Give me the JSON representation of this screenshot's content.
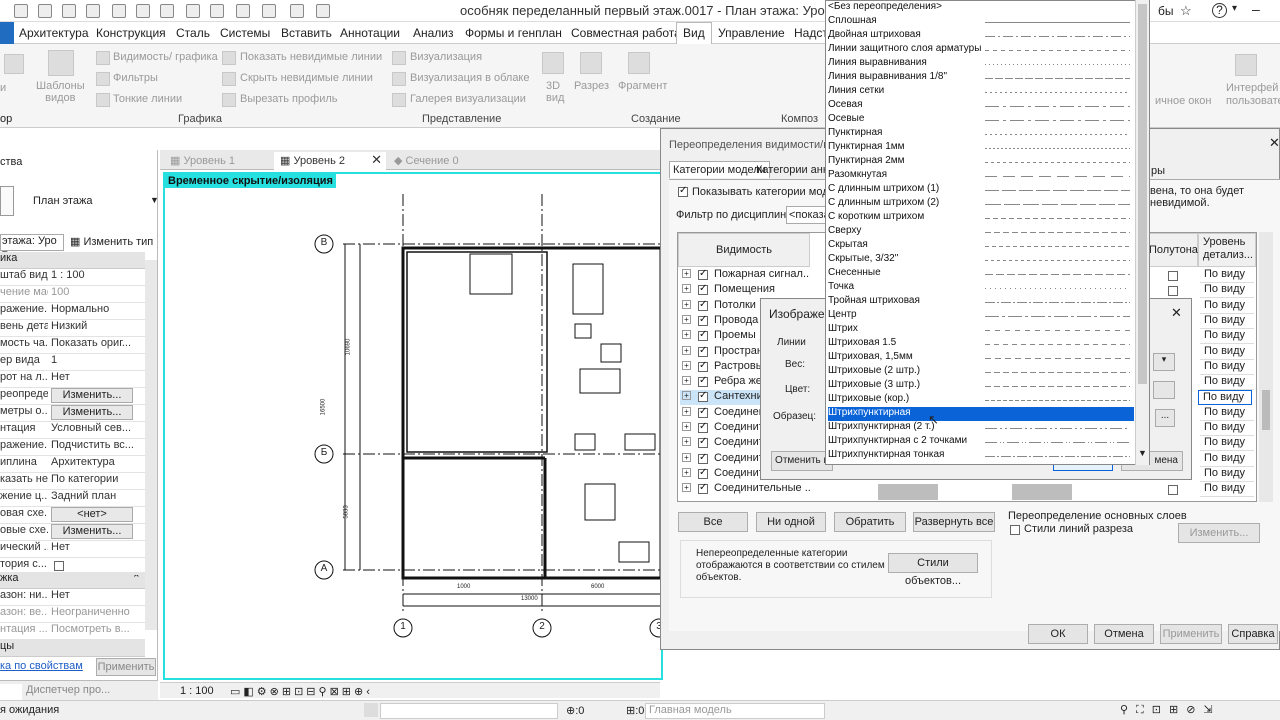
{
  "window_title": "особняк переделанный первый этаж.0017 - План этажа: Уровень 2",
  "title_right": "бы",
  "menu": [
    "Архитектура",
    "Конструкция",
    "Сталь",
    "Системы",
    "Вставить",
    "Аннотации",
    "Анализ",
    "Формы и генплан",
    "Совместная работа",
    "Вид",
    "Управление",
    "Надстр"
  ],
  "ribbon": {
    "templates": "Шаблоны\nвидов",
    "vis_graphics": "Видимость/ графика",
    "filters": "Фильтры",
    "thin_lines": "Тонкие линии",
    "show_hidden": "Показать невидимые линии",
    "hide_hidden": "Скрыть невидимые линии",
    "cut_profile": "Вырезать профиль",
    "render": "Визуализация",
    "render_cloud": "Визуализация  в облаке",
    "render_gallery": "Галерея  визуализации",
    "view_3d": "3D\nвид",
    "section": "Разрез",
    "fragment": "Фрагмент",
    "group_graphics": "Графика",
    "group_presentation": "Представление",
    "group_create": "Создание",
    "group_compose": "Композ",
    "right1": "ичное окон",
    "right2": "Интерфей\nпользовате"
  },
  "left_label_top": "ор",
  "props": {
    "header": "ства",
    "type_name": "План этажа",
    "view_selector": "этажа: Уро",
    "edit_type": "Изменить тип",
    "section_graphics": "ика",
    "rows": [
      {
        "k": "штаб вида",
        "v": "1 : 100"
      },
      {
        "k": "чение мас...",
        "v": "100",
        "grey": true
      },
      {
        "k": "ражение...",
        "v": "Нормально"
      },
      {
        "k": "вень дета...",
        "v": "Низкий"
      },
      {
        "k": "мость ча...",
        "v": "Показать ориг..."
      },
      {
        "k": "ер вида",
        "v": "1"
      },
      {
        "k": "рот на л...",
        "v": "Нет"
      },
      {
        "k": "реопредел...",
        "v": "Изменить...",
        "btn": true
      },
      {
        "k": "метры о...",
        "v": "Изменить...",
        "btn": true
      },
      {
        "k": "нтация",
        "v": "Условный сев..."
      },
      {
        "k": "ражение...",
        "v": "Подчистить вс..."
      },
      {
        "k": "иплина",
        "v": "Архитектура"
      },
      {
        "k": "казать нев...",
        "v": "По категории"
      },
      {
        "k": "жение ц...",
        "v": "Задний план"
      },
      {
        "k": "овая схе...",
        "v": "<нет>",
        "btn": true
      },
      {
        "k": "овые схе...",
        "v": "Изменить...",
        "btn": true
      },
      {
        "k": "ический ...",
        "v": "Нет"
      },
      {
        "k": "тория с...",
        "v": ""
      }
    ],
    "section_extents": "жка",
    "rows2": [
      {
        "k": "азон: ни...",
        "v": "Нет"
      },
      {
        "k": "азон: ве...",
        "v": "Неограниченно",
        "grey": true
      },
      {
        "k": "нтация ...",
        "v": "Посмотреть в...",
        "grey": true
      }
    ],
    "section_other": "цы",
    "help_link": "ка по свойствам",
    "apply": "Применить",
    "tab_browser": "Диспетчер про..."
  },
  "view_tabs": [
    "Уровень 1",
    "Уровень 2",
    "Сечение 0"
  ],
  "temp_hide": "Временное скрытие/изоляция",
  "grid": {
    "B": "В",
    "Б": "Б",
    "A": "А",
    "c1": "1",
    "c2": "2",
    "c3": "3",
    "d1": "1000",
    "d2": "6000",
    "d3": "13000",
    "v1": "10690",
    "v2": "16500",
    "v3": "5833"
  },
  "status_scale": "1 : 100",
  "status_wait": "я ожидания",
  "main_model": "Главная модель",
  "zero1": ":0",
  "zero2": ":0",
  "vg": {
    "title": "Переопределения видимости/гр",
    "tab_model": "Категории модели",
    "tab_annot": "Категории аннота",
    "tab_right": "ры",
    "show_cats": "Показывать категории модели на",
    "note_right": "вена, то она будет невидимой.",
    "discipline": "Фильтр по дисциплинам:",
    "discipline_val": "<показа",
    "col_vis": "Видимость",
    "col_half": "Полутона",
    "col_detail": "Уровень детализ...",
    "rows": [
      "Пожарная сигнал...",
      "Помещения",
      "Потолки",
      "Провода",
      "Проемы",
      "Простран",
      "Растровы",
      "Ребра же",
      "Сантехни",
      "Соединен",
      "Соединит",
      "Соединит",
      "Соединит",
      "Соединит",
      "Соединительные ..."
    ],
    "detail_val": "По виду",
    "btn_all": "Все",
    "btn_none": "Ни одной",
    "btn_invert": "Обратить",
    "btn_expand": "Развернуть все",
    "base_override": "Переопределение основных слоев",
    "cut_styles": "Стили линий разреза",
    "btn_edit": "Изменить...",
    "note": "Непереопределенные категории\nотображаются в соответствии со стилем\nобъектов.",
    "btn_styles": "Стили объектов...",
    "btn_ok": "ОК",
    "btn_cancel": "Отмена",
    "btn_apply": "Применить",
    "btn_help": "Справка"
  },
  "sub": {
    "title": "Изображен",
    "lines": "Линии",
    "weight": "Вес:",
    "color": "Цвет:",
    "pattern": "Образец:",
    "reset": "Отменить п",
    "right_btn": "мена",
    "dots": "..."
  },
  "dropdown": [
    "<Без переопределения>",
    "Сплошная",
    "Двойная штриховая",
    "Линии защитного слоя арматуры",
    "Линия выравнивания",
    "Линия выравнивания 1/8\"",
    "Линия сетки",
    "Осевая",
    "Осевые",
    "Пунктирная",
    "Пунктирная 1мм",
    "Пунктирная 2мм",
    "Разомкнутая",
    "С длинным штрихом (1)",
    "С длинным штрихом (2)",
    "С коротким штрихом",
    "Сверху",
    "Скрытая",
    "Скрытые, 3/32\"",
    "Снесенные",
    "Точка",
    "Тройная штриховая",
    "Центр",
    "Штрих",
    "Штриховая 1.5",
    "Штриховая, 1,5мм",
    "Штриховые (2 штр.)",
    "Штриховые (3 штр.)",
    "Штриховые (кор.)",
    "Штрихпунктирная",
    "Штрихпунктирная (2 т.)",
    "Штрихпунктирная с 2 точками",
    "Штрихпунктирная тонкая"
  ],
  "dropdown_selected": 29,
  "accent": "#0a64d8",
  "highlight": "#26e0e0"
}
